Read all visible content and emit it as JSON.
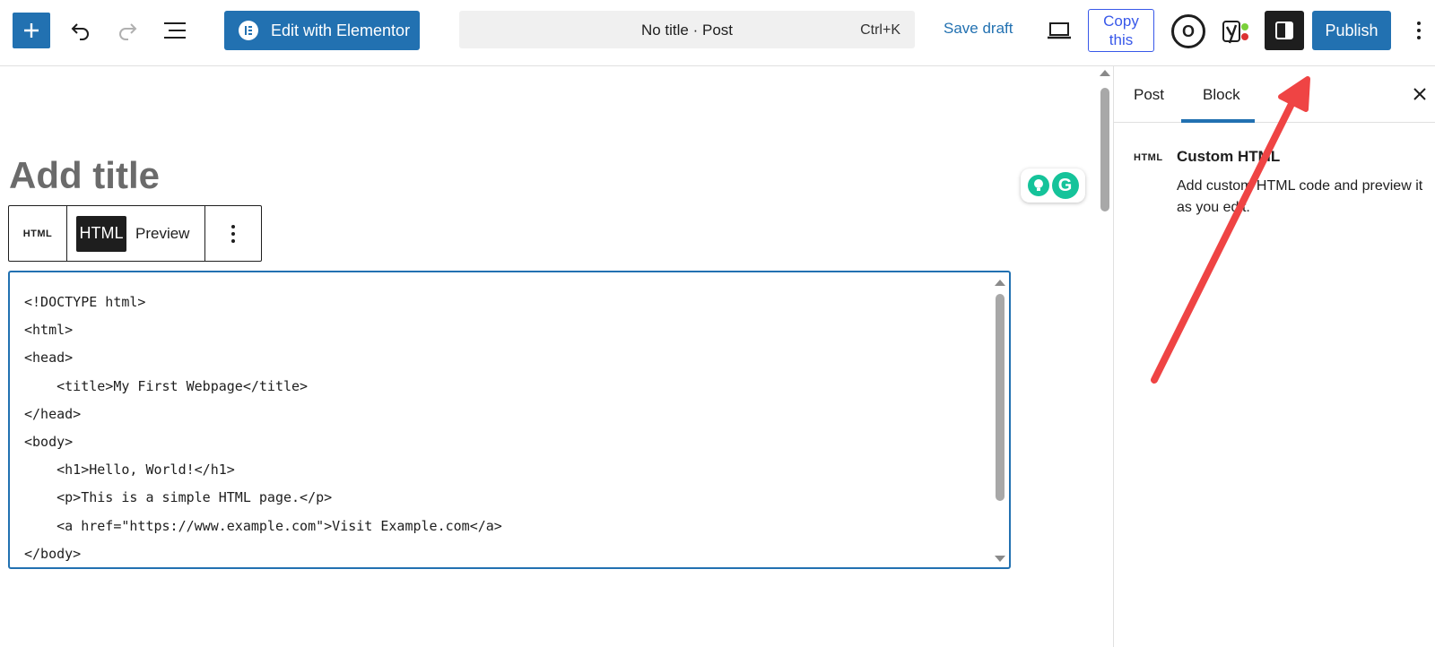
{
  "topbar": {
    "add_block_label": "Add block",
    "elementor_label": "Edit with Elementor",
    "command_title": "No title · Post",
    "command_shortcut": "Ctrl+K",
    "save_draft_label": "Save draft",
    "copy_this_line1": "Copy",
    "copy_this_line2": "this",
    "o_label": "O",
    "publish_label": "Publish"
  },
  "editor": {
    "title_placeholder": "Add title",
    "block_type_label": "HTML",
    "tab_html_label": "HTML",
    "tab_preview_label": "Preview",
    "code_lines": [
      "<!DOCTYPE html>",
      "<html>",
      "<head>",
      "    <title>My First Webpage</title>",
      "</head>",
      "<body>",
      "    <h1>Hello, World!</h1>",
      "    <p>This is a simple HTML page.</p>",
      "    <a href=\"https://www.example.com\">Visit Example.com</a>",
      "</body>"
    ]
  },
  "sidebar": {
    "tab_post": "Post",
    "tab_block": "Block",
    "block_icon_label": "HTML",
    "block_title": "Custom HTML",
    "block_description": "Add custom HTML code and preview it as you edit."
  },
  "colors": {
    "primary": "#2271b1",
    "dark": "#1e1e1e",
    "annotation_arrow": "#ef4444",
    "grammarly": "#15c39a"
  }
}
